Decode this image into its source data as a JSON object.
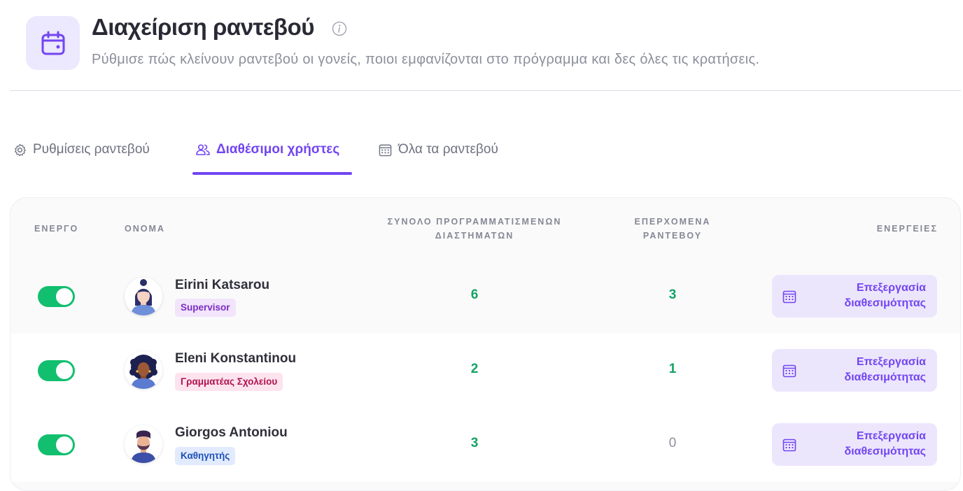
{
  "header": {
    "title": "Διαχείριση ραντεβού",
    "subtitle": "Ρύθμισε πώς κλείνουν ραντεβού οι γονείς, ποιοι εμφανίζονται στο πρόγραμμα και δες όλες τις κρατήσεις.",
    "icon": "calendar-icon",
    "accent": "#7245f2"
  },
  "tabs": [
    {
      "label": "Ρυθμίσεις ραντεβού",
      "icon": "gear-icon",
      "active": false
    },
    {
      "label": "Διαθέσιμοι χρήστες",
      "icon": "users-icon",
      "active": true
    },
    {
      "label": "Όλα τα ραντεβού",
      "icon": "calendar-grid-icon",
      "active": false
    }
  ],
  "table": {
    "headers": {
      "active": "ΕΝΕΡΓΟ",
      "name": "ΟΝΟΜΑ",
      "total_line1": "ΣΥΝΟΛΟ ΠΡΟΓΡΑΜΜΑΤΙΣΜΕΝΩΝ",
      "total_line2": "ΔΙΑΣΤΗΜΑΤΩΝ",
      "upcoming_line1": "ΕΠΕΡΧΟΜΕΝΑ",
      "upcoming_line2": "ΡΑΝΤΕΒΟΥ",
      "actions": "ΕΝΕΡΓΕΙΕΣ"
    },
    "rows": [
      {
        "name": "Eirini Katsarou",
        "role": "Supervisor",
        "role_color": "#7b2cc2",
        "role_bg": "#f1e4fb",
        "active": true,
        "total": "6",
        "upcoming": "3",
        "action_line1": "Επεξεργασία",
        "action_line2": "διαθεσιμότητας"
      },
      {
        "name": "Eleni Konstantinou",
        "role": "Γραμματέας Σχολείου",
        "role_color": "#b0134f",
        "role_bg": "#fde3ee",
        "active": true,
        "total": "2",
        "upcoming": "1",
        "action_line1": "Επεξεργασία",
        "action_line2": "διαθεσιμότητας"
      },
      {
        "name": "Giorgos Antoniou",
        "role": "Καθηγητής",
        "role_color": "#1f4fb8",
        "role_bg": "#e1ebfd",
        "active": true,
        "total": "3",
        "upcoming": "0",
        "action_line1": "Επεξεργασία",
        "action_line2": "διαθεσιμότητας"
      }
    ]
  }
}
